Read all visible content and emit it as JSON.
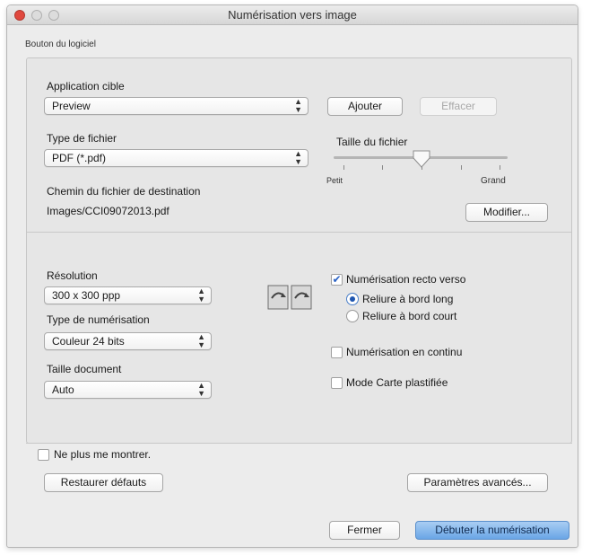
{
  "window": {
    "title": "Numérisation vers image"
  },
  "software_button": {
    "label": "Bouton du logiciel"
  },
  "target_app": {
    "label": "Application cible",
    "value": "Preview",
    "add_label": "Ajouter",
    "clear_label": "Effacer"
  },
  "file_type": {
    "label": "Type de fichier",
    "value": "PDF (*.pdf)"
  },
  "file_size": {
    "label": "Taille du fichier",
    "min_label": "Petit",
    "max_label": "Grand"
  },
  "destination": {
    "label": "Chemin du fichier de destination",
    "path": "Images/CCI09072013.pdf",
    "modify_label": "Modifier..."
  },
  "resolution": {
    "label": "Résolution",
    "value": "300 x 300 ppp"
  },
  "scan_type": {
    "label": "Type de numérisation",
    "value": "Couleur 24 bits"
  },
  "doc_size": {
    "label": "Taille document",
    "value": "Auto"
  },
  "duplex": {
    "label": "Numérisation recto verso",
    "checked": true,
    "long_edge": "Reliure à bord long",
    "short_edge": "Reliure à bord court"
  },
  "continuous": {
    "label": "Numérisation en continu",
    "checked": false
  },
  "card_mode": {
    "label": "Mode Carte plastifiée",
    "checked": false
  },
  "dont_show": {
    "label": "Ne plus me montrer.",
    "checked": false
  },
  "restore_label": "Restaurer défauts",
  "advanced_label": "Paramètres avancés...",
  "close_label": "Fermer",
  "start_label": "Débuter la numérisation",
  "colors": {
    "accent": "#2a62c4",
    "primary_button": "#6aa6e6",
    "close_dot": "#e0483e"
  }
}
